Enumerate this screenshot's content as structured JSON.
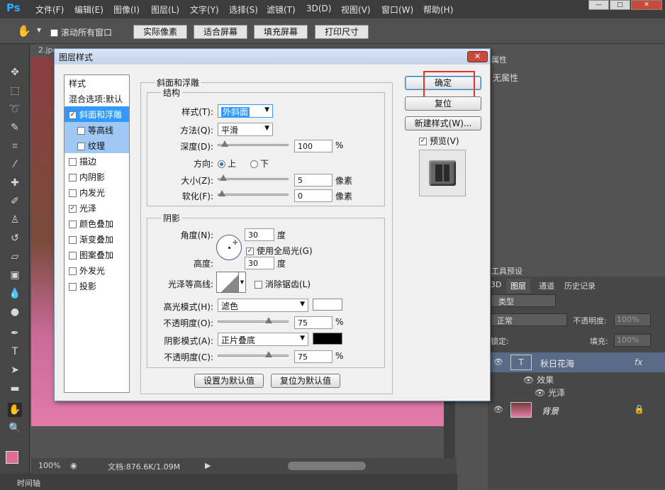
{
  "app": {
    "logo": "Ps"
  },
  "menu": [
    "文件(F)",
    "编辑(E)",
    "图像(I)",
    "图层(L)",
    "文字(Y)",
    "选择(S)",
    "滤镜(T)",
    "3D(D)",
    "视图(V)",
    "窗口(W)",
    "帮助(H)"
  ],
  "window_controls": {
    "minimize": "—",
    "restore": "□",
    "close": "✕"
  },
  "options_bar": {
    "scroll_all": "滚动所有窗口",
    "scroll_all_checked": false,
    "buttons": [
      "实际像素",
      "适合屏幕",
      "填充屏幕",
      "打印尺寸"
    ]
  },
  "document": {
    "tab": "2.jpe"
  },
  "status": {
    "zoom": "100%",
    "doc": "文档:876.6K/1.09M"
  },
  "timeline": "时间轴",
  "right_panels": {
    "properties_tab": "属性",
    "no_properties": "无属性",
    "tool_presets": "工具预设",
    "tabs": [
      "3D",
      "图层",
      "通道",
      "历史记录"
    ],
    "filter_kind": "类型",
    "blend_mode": "正常",
    "opacity_label": "不透明度:",
    "opacity_value": "100%",
    "lock_label": "锁定:",
    "fill_label": "填充:",
    "fill_value": "100%",
    "layers": [
      {
        "name": "秋日花海",
        "thumb": "T",
        "fx": "fx"
      },
      {
        "name": "效果"
      },
      {
        "name": "光泽"
      },
      {
        "name": "背景"
      }
    ]
  },
  "dialog": {
    "title": "图层样式",
    "close": "✕",
    "style_list": {
      "header": "样式",
      "blend": "混合选项:默认",
      "items": [
        {
          "label": "斜面和浮雕",
          "checked": true,
          "state": "selected"
        },
        {
          "label": "等高线",
          "checked": false,
          "state": "sub"
        },
        {
          "label": "纹理",
          "checked": false,
          "state": "sub"
        },
        {
          "label": "描边",
          "checked": false
        },
        {
          "label": "内阴影",
          "checked": false
        },
        {
          "label": "内发光",
          "checked": false
        },
        {
          "label": "光泽",
          "checked": true
        },
        {
          "label": "颜色叠加",
          "checked": false
        },
        {
          "label": "渐变叠加",
          "checked": false
        },
        {
          "label": "图案叠加",
          "checked": false
        },
        {
          "label": "外发光",
          "checked": false
        },
        {
          "label": "投影",
          "checked": false
        }
      ]
    },
    "bevel": {
      "group_title": "斜面和浮雕",
      "structure_title": "结构",
      "style_label": "样式(T):",
      "style_value": "外斜面",
      "technique_label": "方法(Q):",
      "technique_value": "平滑",
      "depth_label": "深度(D):",
      "depth_value": "100",
      "depth_unit": "%",
      "depth_level": 0.05,
      "direction_label": "方向:",
      "direction_up": "上",
      "direction_down": "下",
      "direction_selected": "上",
      "size_label": "大小(Z):",
      "size_value": "5",
      "size_unit": "像素",
      "size_level": 0.02,
      "soften_label": "软化(F):",
      "soften_value": "0",
      "soften_unit": "像素",
      "soften_level": 0.0
    },
    "shading": {
      "title": "阴影",
      "angle_label": "角度(N):",
      "angle_value": "30",
      "angle_unit": "度",
      "global_light": "使用全局光(G)",
      "global_light_checked": true,
      "altitude_label": "高度:",
      "altitude_value": "30",
      "altitude_unit": "度",
      "gloss_label": "光泽等高线:",
      "anti_alias": "消除锯齿(L)",
      "anti_alias_checked": false,
      "highlight_label": "高光模式(H):",
      "highlight_value": "滤色",
      "highlight_color": "#ffffff",
      "h_opacity_label": "不透明度(O):",
      "h_opacity_value": "75",
      "h_opacity_unit": "%",
      "h_opacity_level": 0.75,
      "shadow_label": "阴影模式(A):",
      "shadow_value": "正片叠底",
      "shadow_color": "#000000",
      "s_opacity_label": "不透明度(C):",
      "s_opacity_value": "75",
      "s_opacity_unit": "%",
      "s_opacity_level": 0.75
    },
    "make_default": "设置为默认值",
    "reset_default": "复位为默认值",
    "buttons": {
      "ok": "确定",
      "reset": "复位",
      "new_style": "新建样式(W)...",
      "preview": "预览(V)",
      "preview_checked": true
    }
  },
  "colors": {
    "highlight_box": "#e8322c",
    "selection": "#3399ff",
    "ps_blue": "#31a8ff"
  }
}
